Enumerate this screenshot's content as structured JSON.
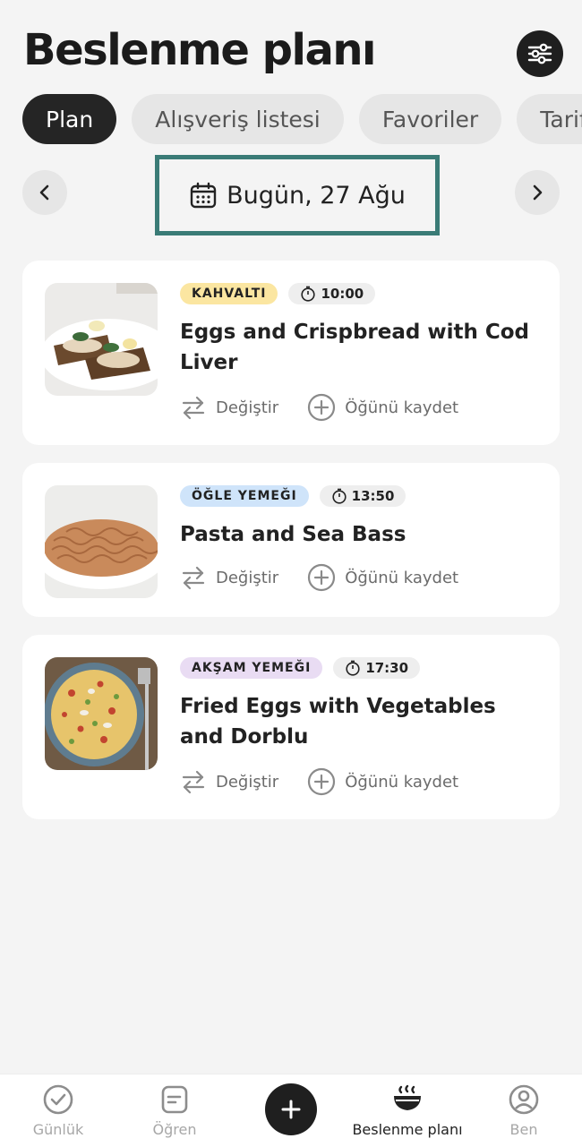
{
  "header": {
    "title": "Beslenme planı",
    "settings_icon": "sliders-icon"
  },
  "tabs": [
    {
      "label": "Plan",
      "active": true
    },
    {
      "label": "Alışveriş listesi",
      "active": false
    },
    {
      "label": "Favoriler",
      "active": false
    },
    {
      "label": "Tarifler",
      "active": false
    }
  ],
  "date_nav": {
    "label": "Bugün, 27 Ağu",
    "prev_icon": "chevron-left-icon",
    "next_icon": "chevron-right-icon",
    "highlight_color": "#3a7b76"
  },
  "meals": [
    {
      "type": "KAHVALTI",
      "type_color": "#fbe6a1",
      "time": "10:00",
      "title": "Eggs and Crispbread with Cod Liver",
      "swap_label": "Değiştir",
      "save_label": "Öğünü kaydet"
    },
    {
      "type": "ÖĞLE YEMEĞI",
      "type_color": "#cfe4fa",
      "time": "13:50",
      "title": "Pasta and Sea Bass",
      "swap_label": "Değiştir",
      "save_label": "Öğünü kaydet"
    },
    {
      "type": "AKŞAM YEMEĞI",
      "type_color": "#e9dcf3",
      "time": "17:30",
      "title": "Fried Eggs with Vegetables and Dorblu",
      "swap_label": "Değiştir",
      "save_label": "Öğünü kaydet"
    }
  ],
  "bottom_nav": [
    {
      "label": "Günlük",
      "icon": "check-circle-icon",
      "active": false
    },
    {
      "label": "Öğren",
      "icon": "note-icon",
      "active": false
    },
    {
      "label": "",
      "icon": "plus-icon",
      "active": false
    },
    {
      "label": "Beslenme planı",
      "icon": "bowl-icon",
      "active": true
    },
    {
      "label": "Ben",
      "icon": "profile-icon",
      "active": false
    }
  ]
}
